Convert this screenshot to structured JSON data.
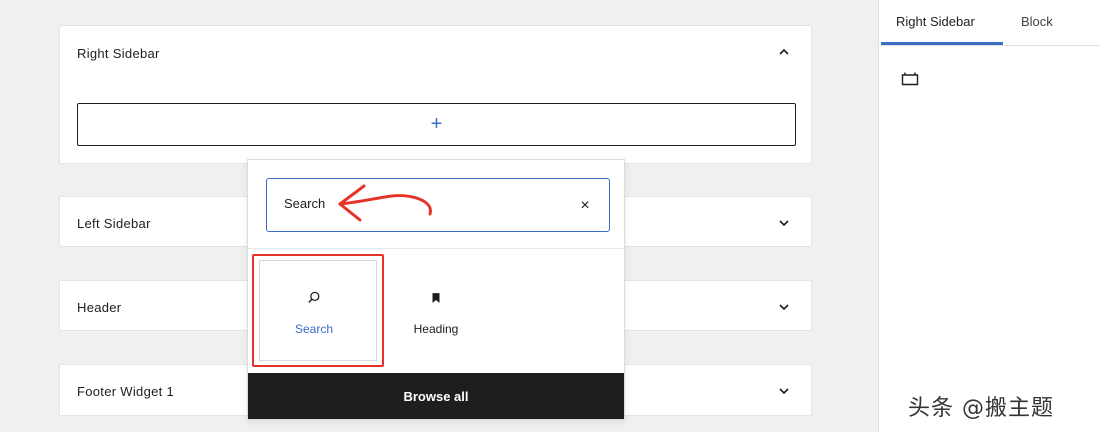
{
  "widget_areas": {
    "right_sidebar": {
      "title": "Right Sidebar",
      "appender_symbol": "+"
    },
    "left_sidebar": {
      "title": "Left Sidebar"
    },
    "header": {
      "title": "Header"
    },
    "footer_widget_1": {
      "title": "Footer Widget 1"
    }
  },
  "inserter": {
    "search": {
      "value": "Search",
      "clear_symbol": "×"
    },
    "results": [
      {
        "label": "Search",
        "icon": "search-icon"
      },
      {
        "label": "Heading",
        "icon": "bookmark-icon"
      }
    ],
    "browse_all_label": "Browse all"
  },
  "sidebar": {
    "tabs": [
      {
        "label": "Right Sidebar",
        "active": true
      },
      {
        "label": "Block",
        "active": false
      }
    ],
    "icon": "widget-area-icon"
  },
  "watermark": "头条 @搬主题",
  "colors": {
    "accent": "#3b6dc7",
    "highlight": "#e5332a",
    "dark": "#1e1e1e"
  }
}
